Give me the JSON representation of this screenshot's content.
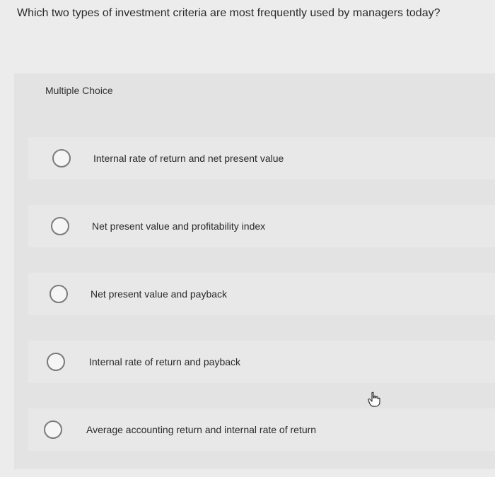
{
  "question": {
    "text": "Which two types of investment criteria are most frequently used by managers today?"
  },
  "prompt": {
    "label": "Multiple Choice"
  },
  "choices": [
    {
      "label": "Internal rate of return and net present value"
    },
    {
      "label": "Net present value and profitability index"
    },
    {
      "label": "Net present value and payback"
    },
    {
      "label": "Internal rate of return and payback"
    },
    {
      "label": "Average accounting return and internal rate of return"
    }
  ],
  "cursor": {
    "icon": "hand-pointer-icon"
  }
}
